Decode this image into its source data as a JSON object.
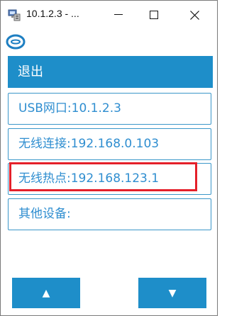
{
  "window": {
    "title": "10.1.2.3 - ...",
    "minimize_glyph": "—",
    "maximize_glyph": "☐",
    "close_glyph": "✕",
    "app_icon": "network-computer-icon"
  },
  "header": {
    "ring_icon": "ring-logo-icon"
  },
  "menu": {
    "exit_label": "退出",
    "items": [
      {
        "label": "USB网口:10.1.2.3"
      },
      {
        "label": "无线连接:192.168.0.103"
      },
      {
        "label": "无线热点:192.168.123.1",
        "highlighted": true
      },
      {
        "label": "其他设备:"
      }
    ]
  },
  "nav": {
    "up_glyph": "▲",
    "down_glyph": "▼"
  },
  "colors": {
    "accent": "#1e8ec9",
    "item_text": "#2f8ed0",
    "item_border": "#3b97c9",
    "highlight": "#e4202a"
  }
}
